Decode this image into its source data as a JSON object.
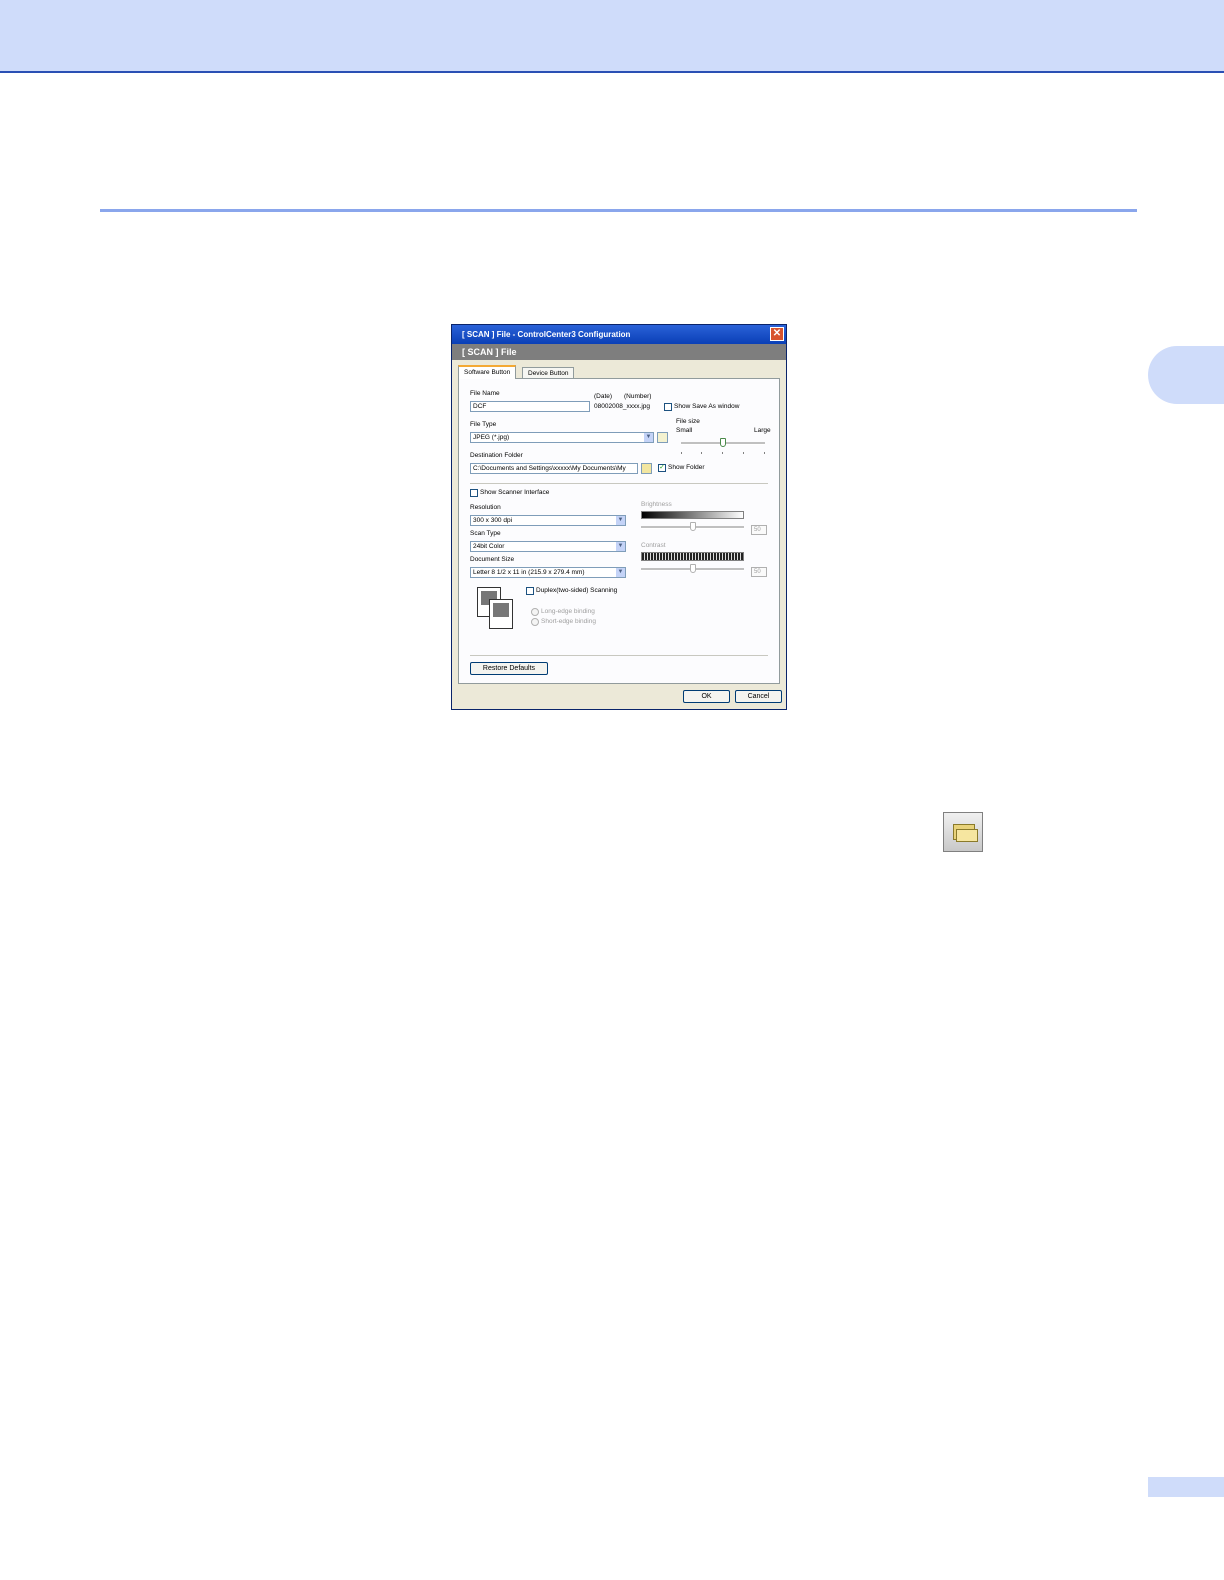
{
  "dialog": {
    "title": "[  SCAN  ]   File - ControlCenter3 Configuration",
    "subheader": "[  SCAN  ]   File",
    "tabs": [
      "Software Button",
      "Device Button"
    ],
    "file_name": {
      "label": "File Name",
      "value": "DCF",
      "date_label": "(Date)",
      "number_label": "(Number)",
      "sample": "08002008_xxxx.jpg"
    },
    "show_save_as": {
      "label": "Show Save As window",
      "checked": false
    },
    "file_type": {
      "label": "File Type",
      "value": "JPEG (*.jpg)"
    },
    "file_size": {
      "label": "File size",
      "small": "Small",
      "large": "Large",
      "level": 0.45
    },
    "destination": {
      "label": "Destination Folder",
      "value": "C:\\Documents and Settings\\xxxxx\\My Documents\\My"
    },
    "show_folder": {
      "label": "Show Folder",
      "checked": true
    },
    "show_scanner": {
      "label": "Show Scanner Interface",
      "checked": false
    },
    "resolution": {
      "label": "Resolution",
      "value": "300 x 300 dpi"
    },
    "scan_type": {
      "label": "Scan Type",
      "value": "24bit Color"
    },
    "document_size": {
      "label": "Document Size",
      "value": "Letter 8 1/2 x 11 in (215.9 x 279.4 mm)"
    },
    "brightness": {
      "label": "Brightness",
      "value": "50"
    },
    "contrast": {
      "label": "Contrast",
      "value": "50"
    },
    "duplex": {
      "label": "Duplex(two-sided) Scanning",
      "checked": false
    },
    "long_edge": "Long-edge binding",
    "short_edge": "Short-edge binding",
    "restore": "Restore Defaults",
    "ok": "OK",
    "cancel": "Cancel"
  },
  "icons": [
    "close-icon",
    "dropdown-arrow-icon",
    "folder-browse-icon",
    "help-icon",
    "duplex-pages-icon"
  ]
}
